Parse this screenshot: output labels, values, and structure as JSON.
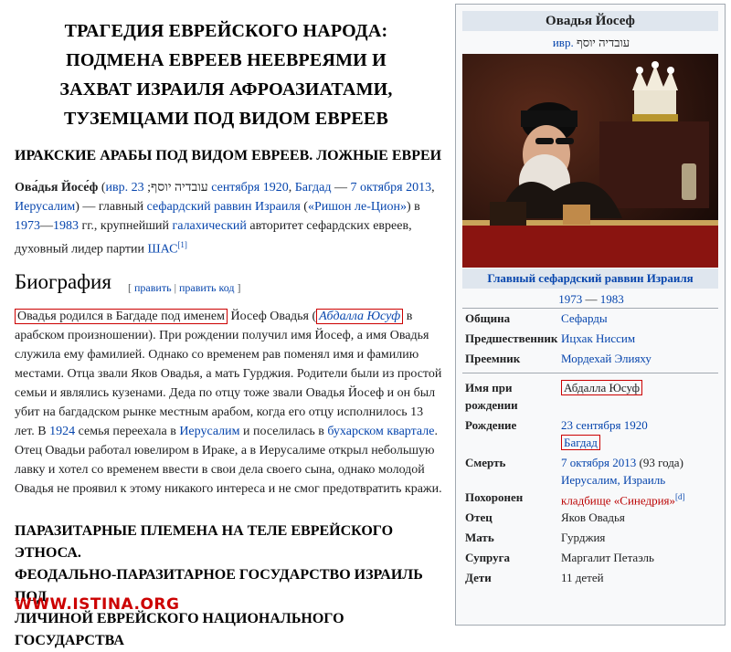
{
  "left": {
    "header_lines": [
      "ТРАГЕДИЯ ЕВРЕЙСКОГО НАРОДА:",
      "ПОДМЕНА ЕВРЕЕВ НЕЕВРЕЯМИ И",
      "ЗАХВАТ ИЗРАИЛЯ АФРОАЗИАТАМИ,",
      "ТУЗЕМЦАМИ ПОД ВИДОМ ЕВРЕЕВ"
    ],
    "subheading": "ИРАКСКИЕ АРАБЫ ПОД ВИДОМ ЕВРЕЕВ. ЛОЖНЫЕ ЕВРЕИ",
    "intro": {
      "name": "Ова́дья Йосе́ф",
      "lang": "ивр.",
      "hebrew": "עובדיה יוסף",
      "birth_date": "23 сентября 1920",
      "birth_place": "Багдад",
      "death_date": "7 октября 2013",
      "death_place": "Иерусалим",
      "t1": "— главный",
      "link1": "сефардский раввин Израиля",
      "link2": "«Ришон ле-Цион»",
      "year1": "1973",
      "year2": "1983",
      "t2": "гг., крупнейший",
      "link3": "галахический",
      "t3": "авторитет сефардских евреев, духовный лидер партии",
      "link4": "ШАС",
      "ref": "[1]"
    },
    "bio_title": "Биография",
    "bio_edit": "правит­ь",
    "bio_edit_code": "править код",
    "bio": {
      "s1": "Овадья родился в Багдаде под именем",
      "s2": "Йосеф Овадья (",
      "s3": "Абдалла Юсуф",
      "s4": "в арабском произношении). При рождении получил имя Йосеф, а имя Овадья служила ему фамилией. Однако со временем рав поменял имя и фамилию местами. Отца звали Яков Овадья, а мать Гурджия. Родители были из простой семьи и являлись кузенами. Деда по отцу тоже звали Овадья Йосеф и он был убит на багдадском рынке местным арабом, когда его отцу исполнилось 13 лет. В",
      "year": "1924",
      "s5": "семья переехала в",
      "link1": "Иерусалим",
      "s6": "и поселилась в",
      "link2": "бухарском квартале",
      "s7": ". Отец Овадьи работал ювелиром в Ираке, а в Иерусалиме открыл небольшую лавку и хотел со временем ввести в свои дела своего сына, однако молодой Овадья не проявил к этому никакого интереса и не смог предотвратить кражи."
    },
    "bottom_lines": [
      "ПАРАЗИТАРНЫЕ ПЛЕМЕНА НА ТЕЛЕ ЕВРЕЙСКОГО ЭТНОСА.",
      "ФЕОДАЛЬНО-ПАРАЗИТАРНОЕ ГОСУДАРСТВО ИЗРАИЛЬ ПОД",
      "ЛИЧИНОЙ ЕВРЕЙСКОГО НАЦИОНАЛЬНОГО ГОСУДАРСТВА"
    ],
    "logo": "WWW.ISTINA.ORG"
  },
  "infobox": {
    "title": "Овадья Йосеф",
    "native_lang": "ивр.",
    "native_name": "עובדיה יוסף",
    "caption": "Главный сефардский раввин Израиля",
    "year_from": "1973",
    "year_dash": "—",
    "year_to": "1983",
    "rows": [
      {
        "label": "Община",
        "value": "Сефарды"
      },
      {
        "label": "Предшественник",
        "value": "Ицхак Ниссим"
      },
      {
        "label": "Преемник",
        "value": "Мордехай Элияху"
      },
      {
        "label": "Имя при рождении",
        "value": "Абдалла Юсуф"
      },
      {
        "label": "Рождение",
        "value": "23 сентября 1920",
        "value2": "Багдад"
      },
      {
        "label": "Смерть",
        "value": "7 октября 2013",
        "value_extra": "(93 года)",
        "value2": "Иерусалим, Израиль"
      },
      {
        "label": "Похоронен",
        "value": "кладбище «Синедрия»",
        "ref": "[d]"
      },
      {
        "label": "Отец",
        "value": "Яков Овадья"
      },
      {
        "label": "Мать",
        "value": "Гурджия"
      },
      {
        "label": "Супруга",
        "value": "Маргалит Петаэль"
      },
      {
        "label": "Дети",
        "value": "11 детей"
      }
    ]
  },
  "colors": {
    "link": "#0645ad",
    "box": "#cc0000",
    "logo": "#cc0000",
    "infobox_header": "#dfe6ee"
  },
  "icons": [
    "rabbi-portrait-photo",
    "crown-icon"
  ]
}
